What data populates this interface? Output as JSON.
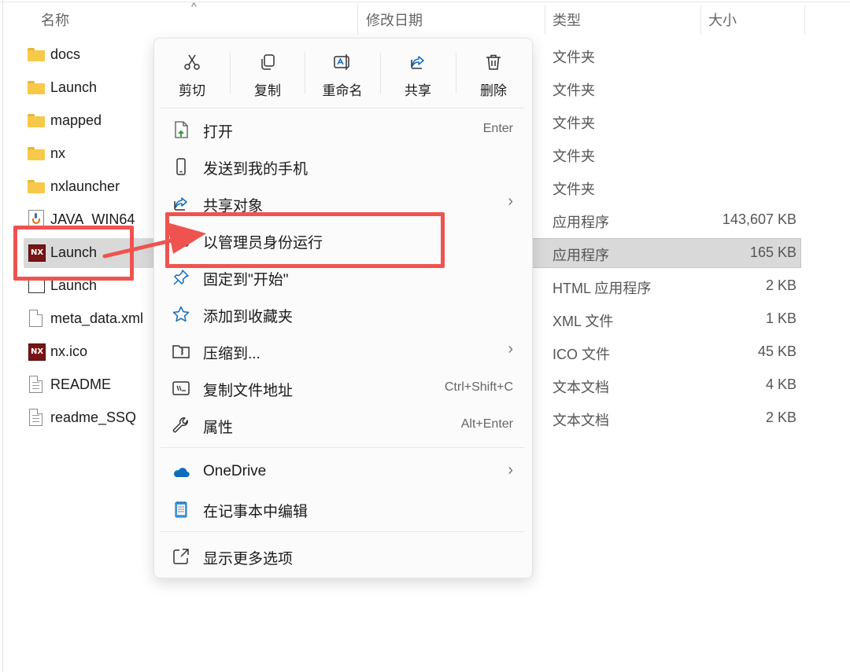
{
  "header": {
    "col_name": "名称",
    "col_date": "修改日期",
    "col_type": "类型",
    "col_size": "大小",
    "sort_indicator": "^"
  },
  "files": [
    {
      "name": "docs",
      "type": "文件夹",
      "size": "",
      "icon": "folder-icon"
    },
    {
      "name": "Launch",
      "type": "文件夹",
      "size": "",
      "icon": "folder-icon"
    },
    {
      "name": "mapped",
      "type": "文件夹",
      "size": "",
      "icon": "folder-icon"
    },
    {
      "name": "nx",
      "type": "文件夹",
      "size": "",
      "icon": "folder-icon"
    },
    {
      "name": "nxlauncher",
      "type": "文件夹",
      "size": "",
      "icon": "folder-icon"
    },
    {
      "name": "JAVA_WIN64",
      "type": "应用程序",
      "size": "143,607 KB",
      "icon": "java-installer-icon"
    },
    {
      "name": "Launch",
      "type": "应用程序",
      "size": "165 KB",
      "icon": "nx-app-icon",
      "selected": true
    },
    {
      "name": "Launch",
      "type": "HTML 应用程序",
      "size": "2 KB",
      "icon": "hta-file-icon"
    },
    {
      "name": "meta_data.xml",
      "type": "XML 文件",
      "size": "1 KB",
      "icon": "document-icon"
    },
    {
      "name": "nx.ico",
      "type": "ICO 文件",
      "size": "45 KB",
      "icon": "nx-app-icon"
    },
    {
      "name": "README",
      "type": "文本文档",
      "size": "4 KB",
      "icon": "text-document-icon"
    },
    {
      "name": "readme_SSQ",
      "type": "文本文档",
      "size": "2 KB",
      "icon": "text-document-icon"
    }
  ],
  "nx_icon_text": "NX",
  "context_menu": {
    "quick_actions": [
      {
        "label": "剪切",
        "icon": "scissors-icon"
      },
      {
        "label": "复制",
        "icon": "copy-icon"
      },
      {
        "label": "重命名",
        "icon": "rename-icon"
      },
      {
        "label": "共享",
        "icon": "share-icon"
      },
      {
        "label": "删除",
        "icon": "trash-icon"
      }
    ],
    "items": [
      {
        "label": "打开",
        "shortcut": "Enter",
        "icon": "open-icon"
      },
      {
        "label": "发送到我的手机",
        "shortcut": "",
        "icon": "phone-icon"
      },
      {
        "label": "共享对象",
        "shortcut": "",
        "icon": "share-with-icon",
        "submenu": true
      },
      {
        "label": "以管理员身份运行",
        "shortcut": "",
        "icon": "run-as-admin-icon"
      },
      {
        "label": "固定到\"开始\"",
        "shortcut": "",
        "icon": "pin-icon"
      },
      {
        "label": "添加到收藏夹",
        "shortcut": "",
        "icon": "star-icon"
      },
      {
        "label": "压缩到...",
        "shortcut": "",
        "icon": "zip-icon",
        "submenu": true
      },
      {
        "label": "复制文件地址",
        "shortcut": "Ctrl+Shift+C",
        "icon": "copy-path-icon"
      },
      {
        "label": "属性",
        "shortcut": "Alt+Enter",
        "icon": "wrench-icon"
      }
    ],
    "extra_items": [
      {
        "label": "OneDrive",
        "shortcut": "",
        "icon": "onedrive-cloud-icon",
        "submenu": true
      },
      {
        "label": "在记事本中编辑",
        "shortcut": "",
        "icon": "notepad-icon"
      }
    ],
    "more_options": {
      "label": "显示更多选项",
      "icon": "expand-icon"
    },
    "submenu_chevron": "›"
  },
  "colors": {
    "annotation_red": "#ef5350",
    "folder_yellow": "#f7c948",
    "selection_gray": "#d9d9d9",
    "onedrive_blue": "#0f6cbd"
  }
}
